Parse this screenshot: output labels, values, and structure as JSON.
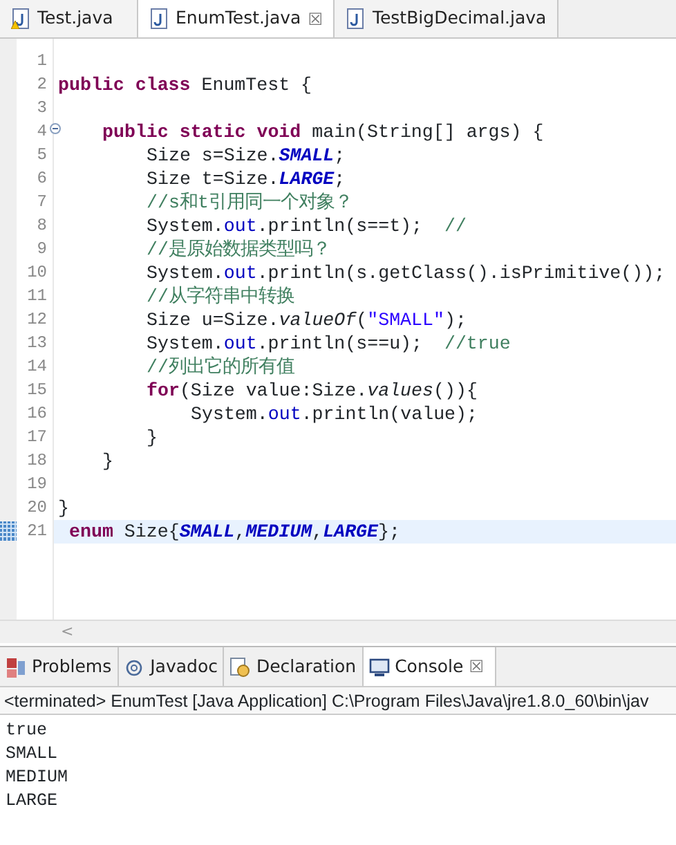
{
  "editor_tabs": [
    {
      "label": "Test.java",
      "selected": false
    },
    {
      "label": "EnumTest.java",
      "selected": true,
      "close": "☒"
    },
    {
      "label": "TestBigDecimal.java",
      "selected": false
    }
  ],
  "code_lines": [
    {
      "number": "1"
    },
    {
      "number": "2",
      "tokens": [
        {
          "kind": "keyword",
          "text": "public class"
        },
        {
          "kind": "plain",
          "text": " EnumTest {"
        }
      ]
    },
    {
      "number": "3"
    },
    {
      "number": "4",
      "folded": false,
      "tokens": [
        {
          "kind": "keyword",
          "text": "public static void"
        },
        {
          "kind": "plain",
          "text": " main(String[] args) {"
        }
      ]
    },
    {
      "number": "5",
      "tokens": [
        {
          "kind": "plain",
          "text": "Size s=Size."
        },
        {
          "kind": "constant",
          "text": "SMALL"
        },
        {
          "kind": "plain",
          "text": ";"
        }
      ]
    },
    {
      "number": "6",
      "tokens": [
        {
          "kind": "plain",
          "text": "Size t=Size."
        },
        {
          "kind": "constant",
          "text": "LARGE"
        },
        {
          "kind": "plain",
          "text": ";"
        }
      ]
    },
    {
      "number": "7",
      "tokens": [
        {
          "kind": "comment",
          "text": "//s和t引用同一个对象？"
        }
      ]
    },
    {
      "number": "8",
      "tokens": [
        {
          "kind": "plain",
          "text": "System."
        },
        {
          "kind": "field",
          "text": "out"
        },
        {
          "kind": "plain",
          "text": ".println(s==t);  "
        },
        {
          "kind": "comment",
          "text": "//"
        }
      ]
    },
    {
      "number": "9",
      "tokens": [
        {
          "kind": "comment",
          "text": "//是原始数据类型吗？"
        }
      ]
    },
    {
      "number": "10",
      "tokens": [
        {
          "kind": "plain",
          "text": "System."
        },
        {
          "kind": "field",
          "text": "out"
        },
        {
          "kind": "plain",
          "text": ".println(s.getClass().isPrimitive());"
        }
      ]
    },
    {
      "number": "11",
      "tokens": [
        {
          "kind": "comment",
          "text": "//从字符串中转换"
        }
      ]
    },
    {
      "number": "12",
      "tokens": [
        {
          "kind": "plain",
          "text": "Size u=Size."
        },
        {
          "kind": "static_method",
          "text": "valueOf"
        },
        {
          "kind": "plain",
          "text": "("
        },
        {
          "kind": "string",
          "text": "\"SMALL\""
        },
        {
          "kind": "plain",
          "text": ");"
        }
      ]
    },
    {
      "number": "13",
      "tokens": [
        {
          "kind": "plain",
          "text": "System."
        },
        {
          "kind": "field",
          "text": "out"
        },
        {
          "kind": "plain",
          "text": ".println(s==u);  "
        },
        {
          "kind": "comment",
          "text": "//true"
        }
      ]
    },
    {
      "number": "14",
      "tokens": [
        {
          "kind": "comment",
          "text": "//列出它的所有值"
        }
      ]
    },
    {
      "number": "15",
      "tokens": [
        {
          "kind": "keyword",
          "text": "for"
        },
        {
          "kind": "plain",
          "text": "(Size value:Size."
        },
        {
          "kind": "static_method",
          "text": "values"
        },
        {
          "kind": "plain",
          "text": "()){"
        }
      ]
    },
    {
      "number": "16",
      "tokens": [
        {
          "kind": "plain",
          "text": "System."
        },
        {
          "kind": "field",
          "text": "out"
        },
        {
          "kind": "plain",
          "text": ".println(value);"
        }
      ]
    },
    {
      "number": "17",
      "tokens": [
        {
          "kind": "plain",
          "text": "}"
        }
      ]
    },
    {
      "number": "18",
      "tokens": [
        {
          "kind": "plain",
          "text": "}"
        }
      ]
    },
    {
      "number": "19"
    },
    {
      "number": "20",
      "tokens": [
        {
          "kind": "plain",
          "text": "}"
        }
      ]
    },
    {
      "number": "21",
      "current": true,
      "tokens": [
        {
          "kind": "keyword",
          "text": "enum"
        },
        {
          "kind": "plain",
          "text": " Size{"
        },
        {
          "kind": "constant",
          "text": "SMALL"
        },
        {
          "kind": "plain",
          "text": ","
        },
        {
          "kind": "constant",
          "text": "MEDIUM"
        },
        {
          "kind": "plain",
          "text": ","
        },
        {
          "kind": "constant",
          "text": "LARGE"
        },
        {
          "kind": "plain",
          "text": "};"
        }
      ]
    }
  ],
  "scroll_arrow": "<",
  "view_tabs": [
    {
      "label": "Problems",
      "selected": false
    },
    {
      "label": "Javadoc",
      "selected": false
    },
    {
      "label": "Declaration",
      "selected": false
    },
    {
      "label": "Console",
      "selected": true,
      "close": "☒"
    }
  ],
  "console": {
    "header": "<terminated> EnumTest [Java Application] C:\\Program Files\\Java\\jre1.8.0_60\\bin\\jav",
    "output": [
      "true",
      "SMALL",
      "MEDIUM",
      "LARGE"
    ]
  }
}
